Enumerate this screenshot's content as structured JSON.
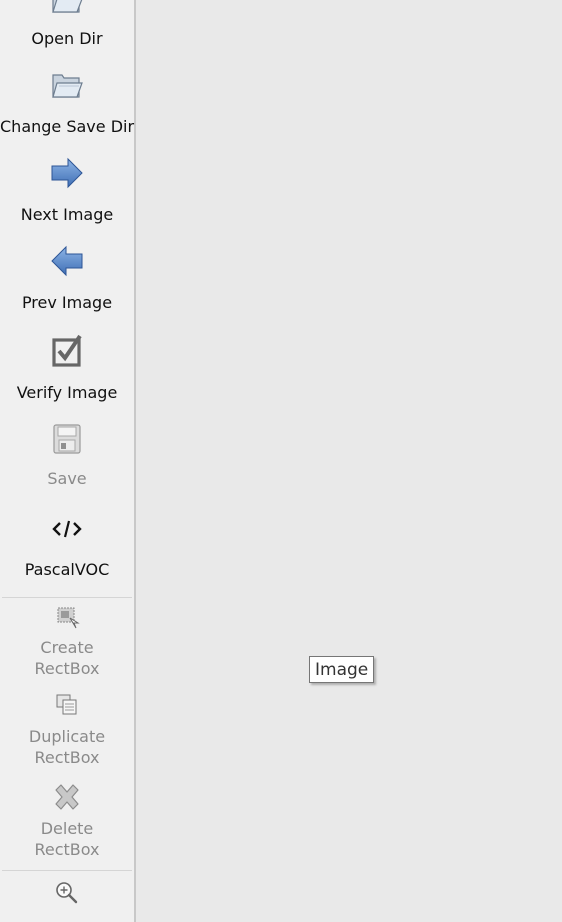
{
  "toolbar": {
    "open_dir": {
      "label": "Open Dir",
      "icon": "folder-open-icon"
    },
    "change_save_dir": {
      "label": "Change Save Dir",
      "icon": "folder-open-icon"
    },
    "next_image": {
      "label": "Next Image",
      "icon": "arrow-right-icon"
    },
    "prev_image": {
      "label": "Prev Image",
      "icon": "arrow-left-icon"
    },
    "verify_image": {
      "label": "Verify Image",
      "icon": "checkbox-icon"
    },
    "save": {
      "label": "Save",
      "icon": "floppy-disk-icon",
      "enabled": false
    },
    "format": {
      "label": "PascalVOC",
      "icon": "code-tag-icon"
    },
    "create_rectbox": {
      "label_line1": "Create",
      "label_line2": "RectBox",
      "icon": "draw-rect-icon",
      "enabled": false
    },
    "duplicate_rectbox": {
      "label_line1": "Duplicate",
      "label_line2": "RectBox",
      "icon": "copy-icon",
      "enabled": false
    },
    "delete_rectbox": {
      "label_line1": "Delete",
      "label_line2": "RectBox",
      "icon": "delete-x-icon",
      "enabled": false
    },
    "zoom_in": {
      "icon": "zoom-in-icon"
    }
  },
  "canvas": {
    "tooltip": "Image"
  },
  "colors": {
    "toolbar_bg": "#f0f0f0",
    "canvas_bg": "#e9e9e9",
    "arrow_blue": "#4a7fc4",
    "disabled_text": "#8a8a8a"
  }
}
